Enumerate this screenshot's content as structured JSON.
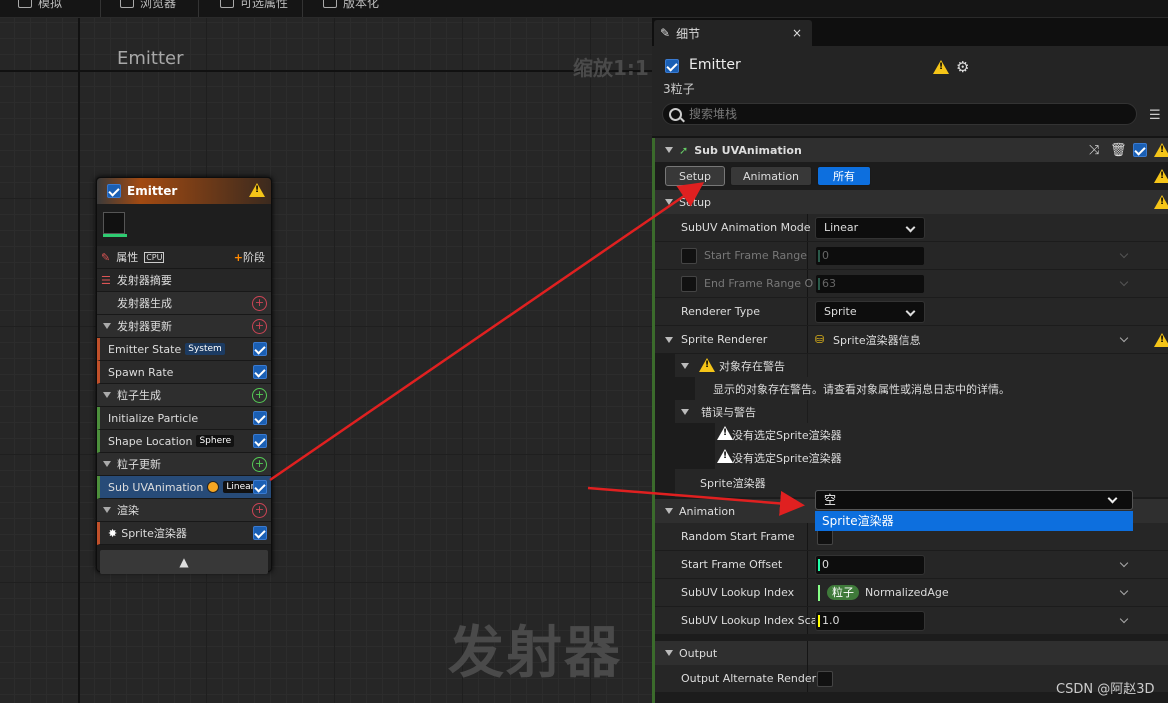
{
  "toolbar": {
    "items": [
      "模拟",
      "浏览器",
      "可选属性",
      "版本化"
    ]
  },
  "graph": {
    "title": "Emitter",
    "zoom": "缩放1:1",
    "watermark": "发射器"
  },
  "node": {
    "title": "Emitter",
    "props_label": "属性",
    "cpu_label": "CPU",
    "stage_label": "阶段",
    "summary": "发射器摘要",
    "emitter_spawn": "发射器生成",
    "emitter_update": "发射器更新",
    "emitter_state": "Emitter State",
    "emitter_state_tag": "System",
    "spawn_rate": "Spawn Rate",
    "particle_spawn": "粒子生成",
    "init_particle": "Initialize Particle",
    "shape_location": "Shape Location",
    "shape_tag": "Sphere",
    "particle_update": "粒子更新",
    "sub_uv": "Sub UVAnimation",
    "sub_uv_tag": "Linear",
    "render": "渲染",
    "sprite_renderer": "Sprite渲染器",
    "collapse": "▲"
  },
  "details": {
    "tab_title": "细节",
    "tab_close": "×",
    "header_title": "Emitter",
    "header_sub": "3粒子",
    "search_placeholder": "搜索堆栈",
    "module_title": "Sub UVAnimation",
    "filter_tabs": [
      "Setup",
      "Animation",
      "所有"
    ],
    "setup_cat": "Setup",
    "subuv_mode_label": "SubUV Animation Mode",
    "subuv_mode_value": "Linear",
    "start_frame_range_label": "Start Frame Range",
    "start_frame_range_value": "0",
    "end_frame_range_label": "End Frame Range O",
    "end_frame_range_value": "63",
    "renderer_type_label": "Renderer Type",
    "renderer_type_value": "Sprite",
    "sprite_renderer_label": "Sprite Renderer",
    "sprite_renderer_value": "Sprite渲染器信息",
    "obj_warn_label": "对象存在警告",
    "obj_warn_text": "显示的对象存在警告。请查看对象属性或消息日志中的详情。",
    "errors_label": "错误与警告",
    "err1": "没有选定Sprite渲染器",
    "err2": "没有选定Sprite渲染器",
    "sprite_renderer_field_label": "Sprite渲染器",
    "dropdown_value": "空",
    "dropdown_option": "Sprite渲染器",
    "animation_cat": "Animation",
    "random_start_label": "Random Start Frame",
    "start_offset_label": "Start Frame Offset",
    "start_offset_value": "0",
    "lookup_index_label": "SubUV Lookup Index",
    "lookup_pill": "粒子",
    "lookup_value": "NormalizedAge",
    "lookup_scale_label": "SubUV Lookup Index Sca",
    "lookup_scale_value": "1.0",
    "output_cat": "Output",
    "output_alt_label": "Output Alternate Render"
  },
  "watermark_text": "CSDN @阿赵3D",
  "colors": {
    "accent": "#0d6fde",
    "warning": "#f5c518",
    "arrow": "#e02020"
  }
}
